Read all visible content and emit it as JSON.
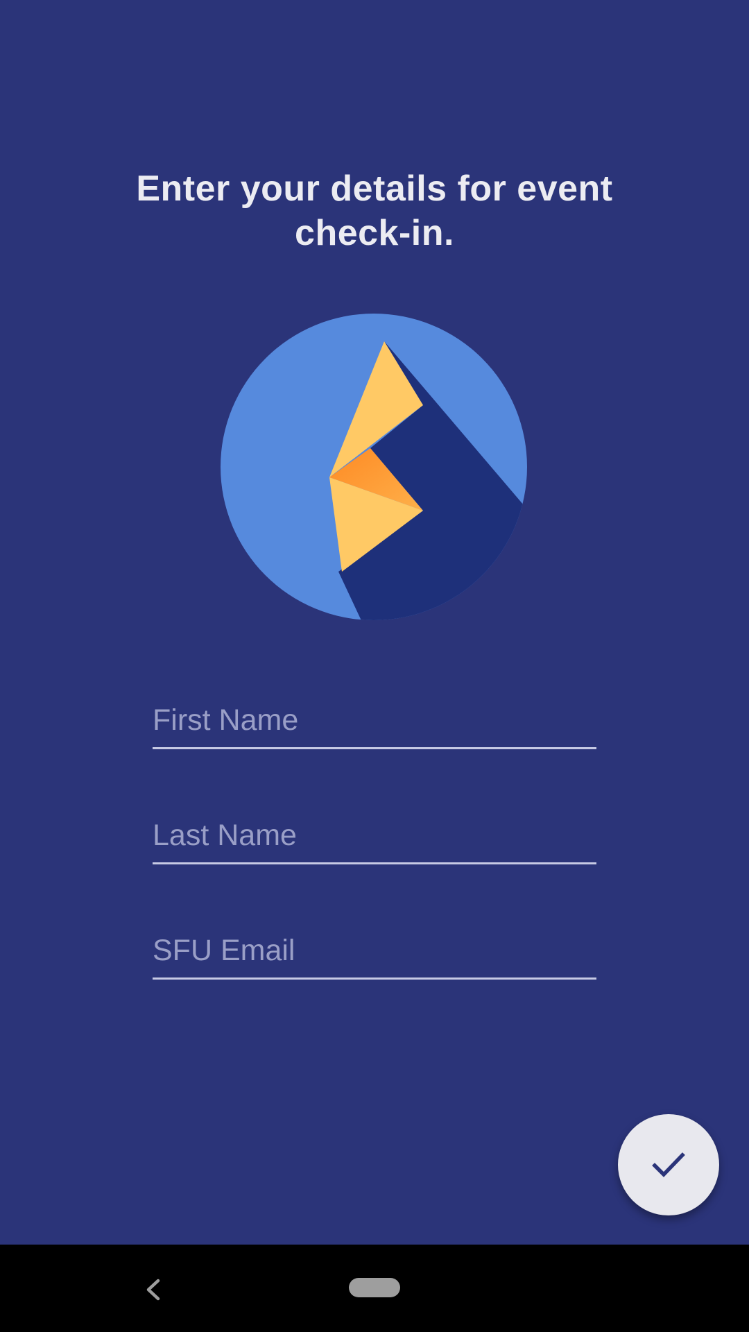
{
  "headline": "Enter your details for event check-in.",
  "logo": {
    "icon": "lightning-bolt-logo-icon"
  },
  "form": {
    "first_name_placeholder": "First Name",
    "last_name_placeholder": "Last Name",
    "email_placeholder": "SFU Email"
  },
  "fab": {
    "icon": "check-icon"
  },
  "navigation": {
    "back_icon": "back-chevron-icon",
    "home_icon": "home-pill-icon"
  },
  "colors": {
    "background": "#2b3479",
    "logo_circle": "#568add",
    "logo_shadow": "#1e307a",
    "bolt_yellow": "#ffc965",
    "bolt_orange": "#ff8c2a",
    "fab_background": "#e8e8ee",
    "check_color": "#2b3479"
  }
}
